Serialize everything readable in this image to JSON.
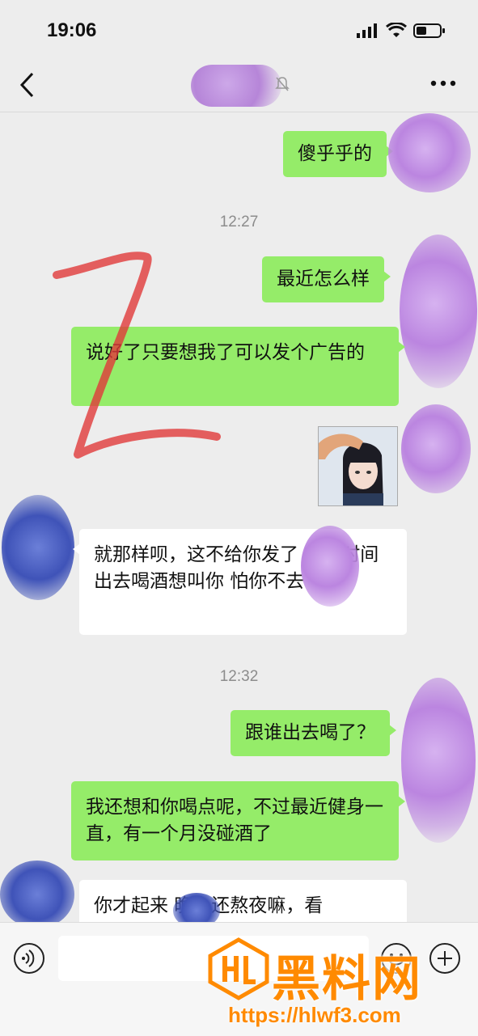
{
  "status": {
    "time": "19:06"
  },
  "messages": {
    "m1": "傻乎乎的",
    "t1": "12:27",
    "m2": "最近怎么样",
    "m3": "说好了只要想我了可以发个广告的",
    "m4": "就那样呗，这不给你发了 前段时间出去喝酒想叫你 怕你不去",
    "t2": "12:32",
    "m5": "跟谁出去喝了？",
    "m6": "我还想和你喝点呢，不过最近健身一直，有一个月没碰酒了",
    "m7": "你才起来 晚上还熬夜嘛，看"
  },
  "watermark": {
    "name": "黑料网",
    "url": "https://hlwf3.com"
  },
  "icons": {
    "back": "back-arrow-icon",
    "more": "more-icon",
    "mute": "bell-off-icon",
    "voice": "voice-icon",
    "emoji": "emoji-icon",
    "plus": "plus-icon"
  },
  "colors": {
    "bg": "#ededed",
    "me_bubble": "#95ec69",
    "other_bubble": "#ffffff",
    "watermark": "#ff8a00"
  }
}
